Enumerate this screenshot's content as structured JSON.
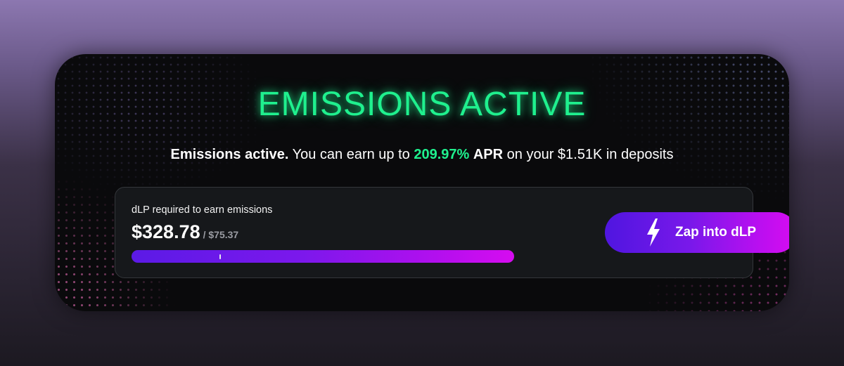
{
  "banner": {
    "title": "EMISSIONS ACTIVE",
    "subtitle": {
      "lead": "Emissions active.",
      "text_before": " You can earn up to ",
      "apr_value": "209.97%",
      "apr_label": "APR",
      "text_after": " on your $1.51K in deposits"
    }
  },
  "requirement": {
    "label": "dLP required to earn emissions",
    "required_value": "$328.78",
    "current_value": "/ $75.37",
    "progress_fraction": 0.229
  },
  "zap_button": {
    "label": "Zap into dLP",
    "icon": "lightning-bolt-icon"
  },
  "colors": {
    "accent_green": "#1ff08e",
    "gradient_start": "#5b1ae6",
    "gradient_end": "#d60cf0",
    "panel_bg": "#16181b"
  }
}
